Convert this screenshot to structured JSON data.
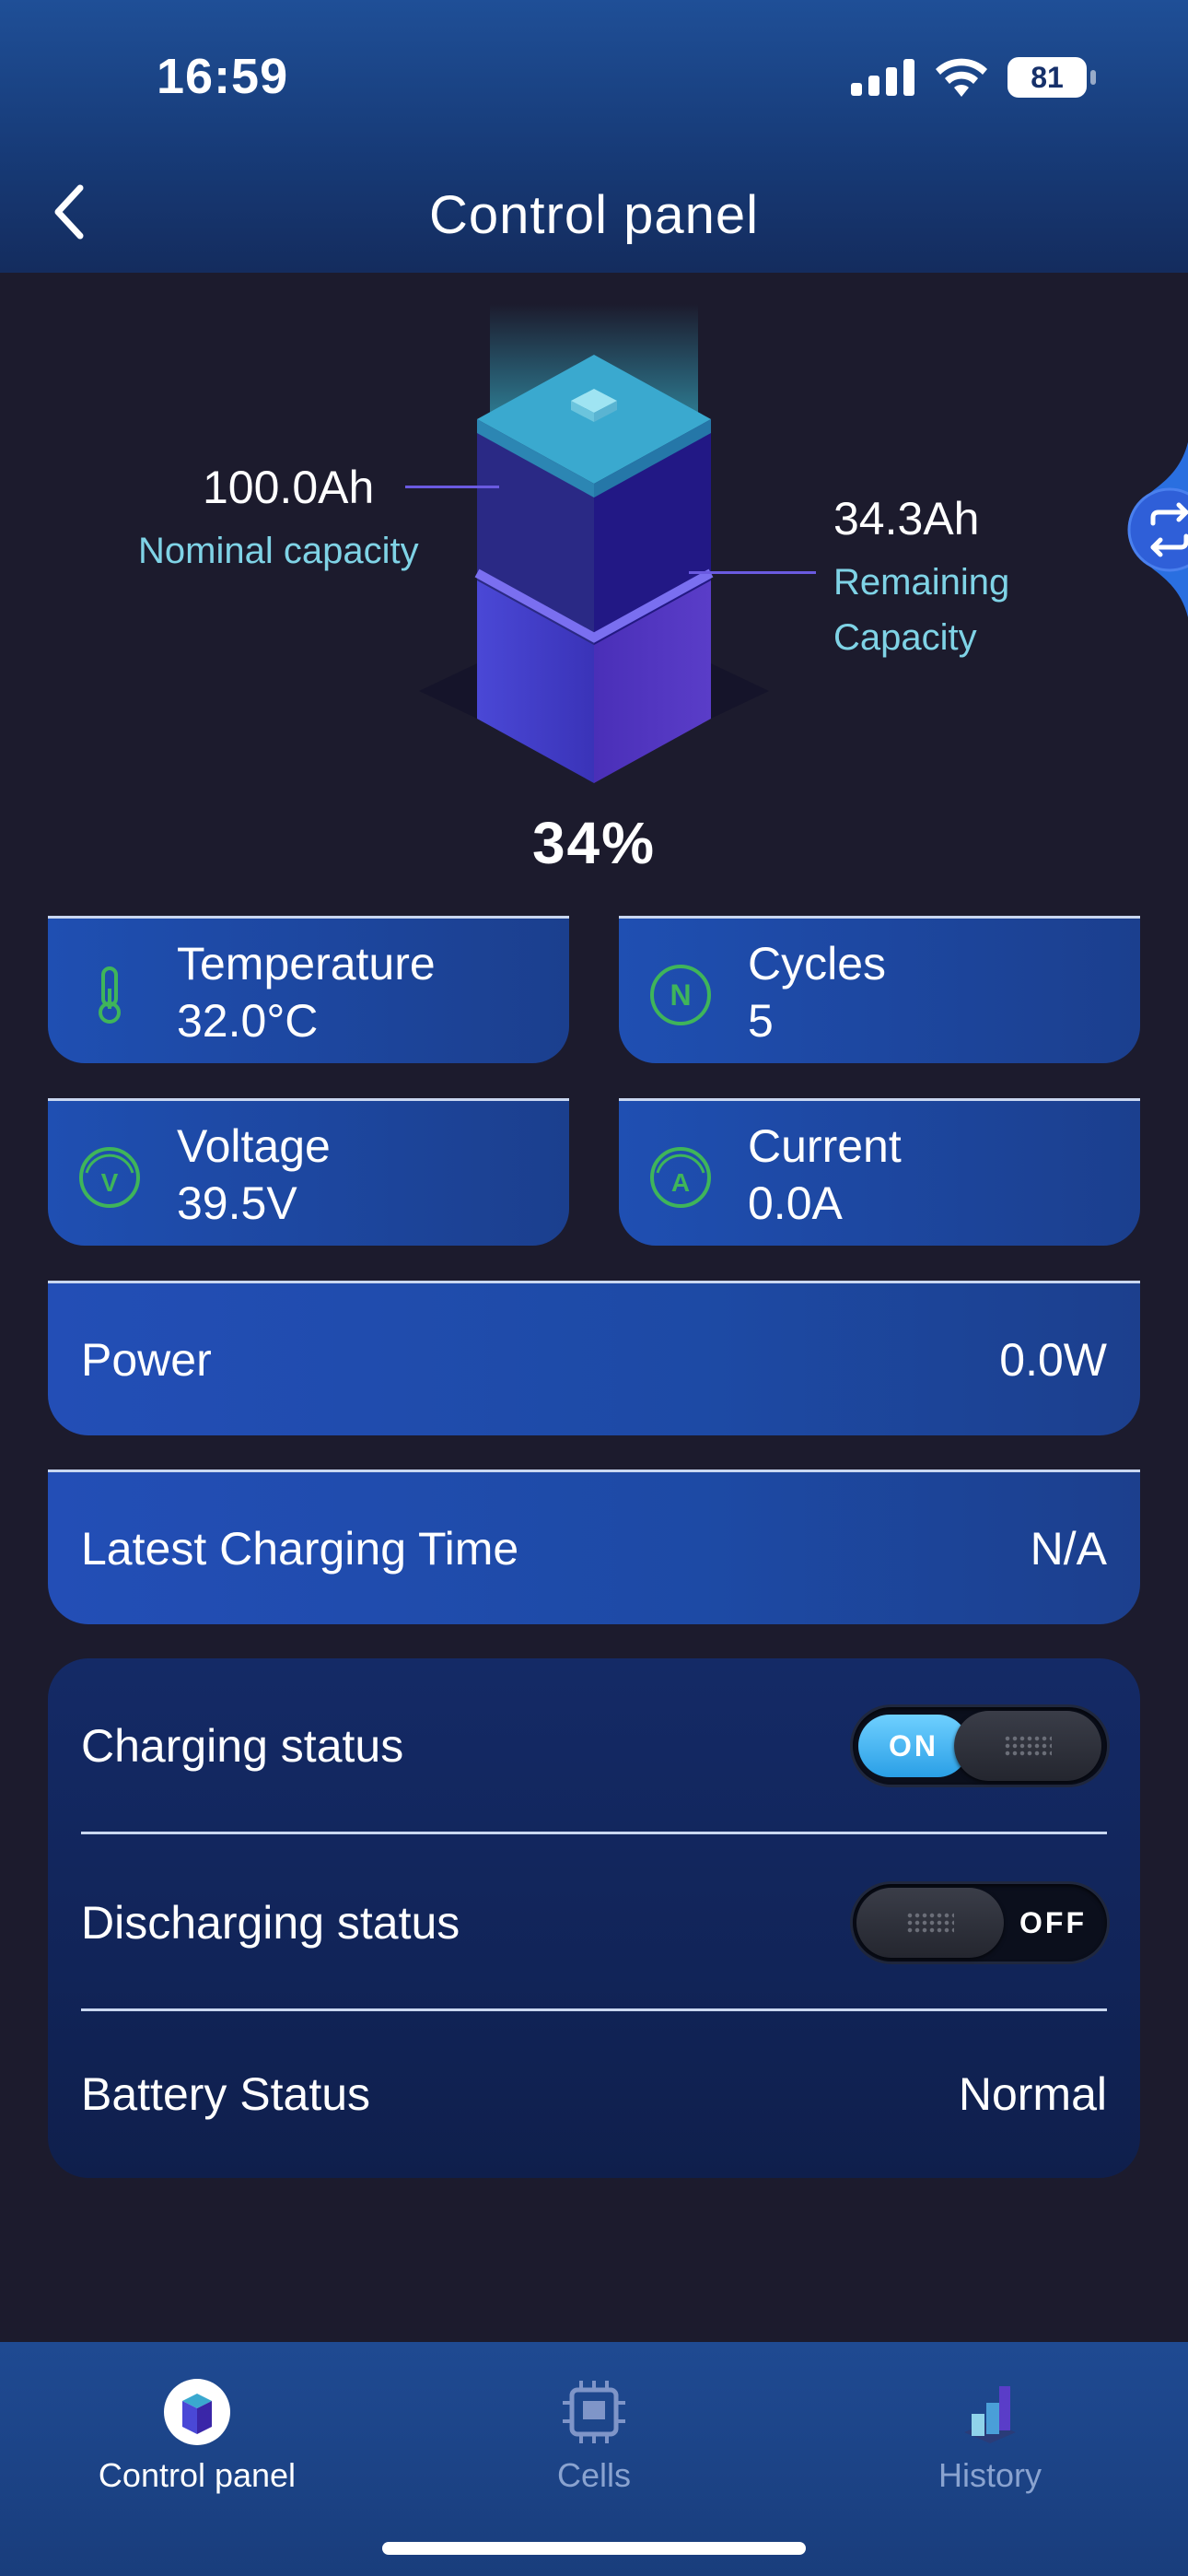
{
  "status_bar": {
    "time": "16:59",
    "battery_level": "81"
  },
  "header": {
    "title": "Control panel"
  },
  "battery_visual": {
    "nominal_value": "100.0Ah",
    "nominal_label": "Nominal capacity",
    "remaining_value": "34.3Ah",
    "remaining_label_line1": "Remaining",
    "remaining_label_line2": "Capacity",
    "percent_text": "34%",
    "fill_fraction": 0.343
  },
  "stats": {
    "temperature": {
      "label": "Temperature",
      "value": "32.0°C"
    },
    "cycles": {
      "label": "Cycles",
      "value": "5",
      "icon_letter": "N"
    },
    "voltage": {
      "label": "Voltage",
      "value": "39.5V",
      "icon_letter": "V"
    },
    "current": {
      "label": "Current",
      "value": "0.0A",
      "icon_letter": "A"
    }
  },
  "power": {
    "label": "Power",
    "value": "0.0W"
  },
  "latest_charging": {
    "label": "Latest Charging Time",
    "value": "N/A"
  },
  "status_panel": {
    "charging": {
      "label": "Charging status",
      "state": "ON"
    },
    "discharging": {
      "label": "Discharging status",
      "state": "OFF"
    },
    "battery": {
      "label": "Battery Status",
      "value": "Normal"
    }
  },
  "tabbar": {
    "tabs": [
      {
        "label": "Control panel",
        "icon": "battery-cube-icon",
        "active": true
      },
      {
        "label": "Cells",
        "icon": "chip-icon",
        "active": false
      },
      {
        "label": "History",
        "icon": "bar-chart-icon",
        "active": false
      }
    ]
  },
  "colors": {
    "background": "#1c1b2d",
    "accent_green": "#3fb55a",
    "capacity_label": "#7fd3e6",
    "card_blue": "#1f4fb2",
    "toggle_on": "#2a9fe6"
  }
}
